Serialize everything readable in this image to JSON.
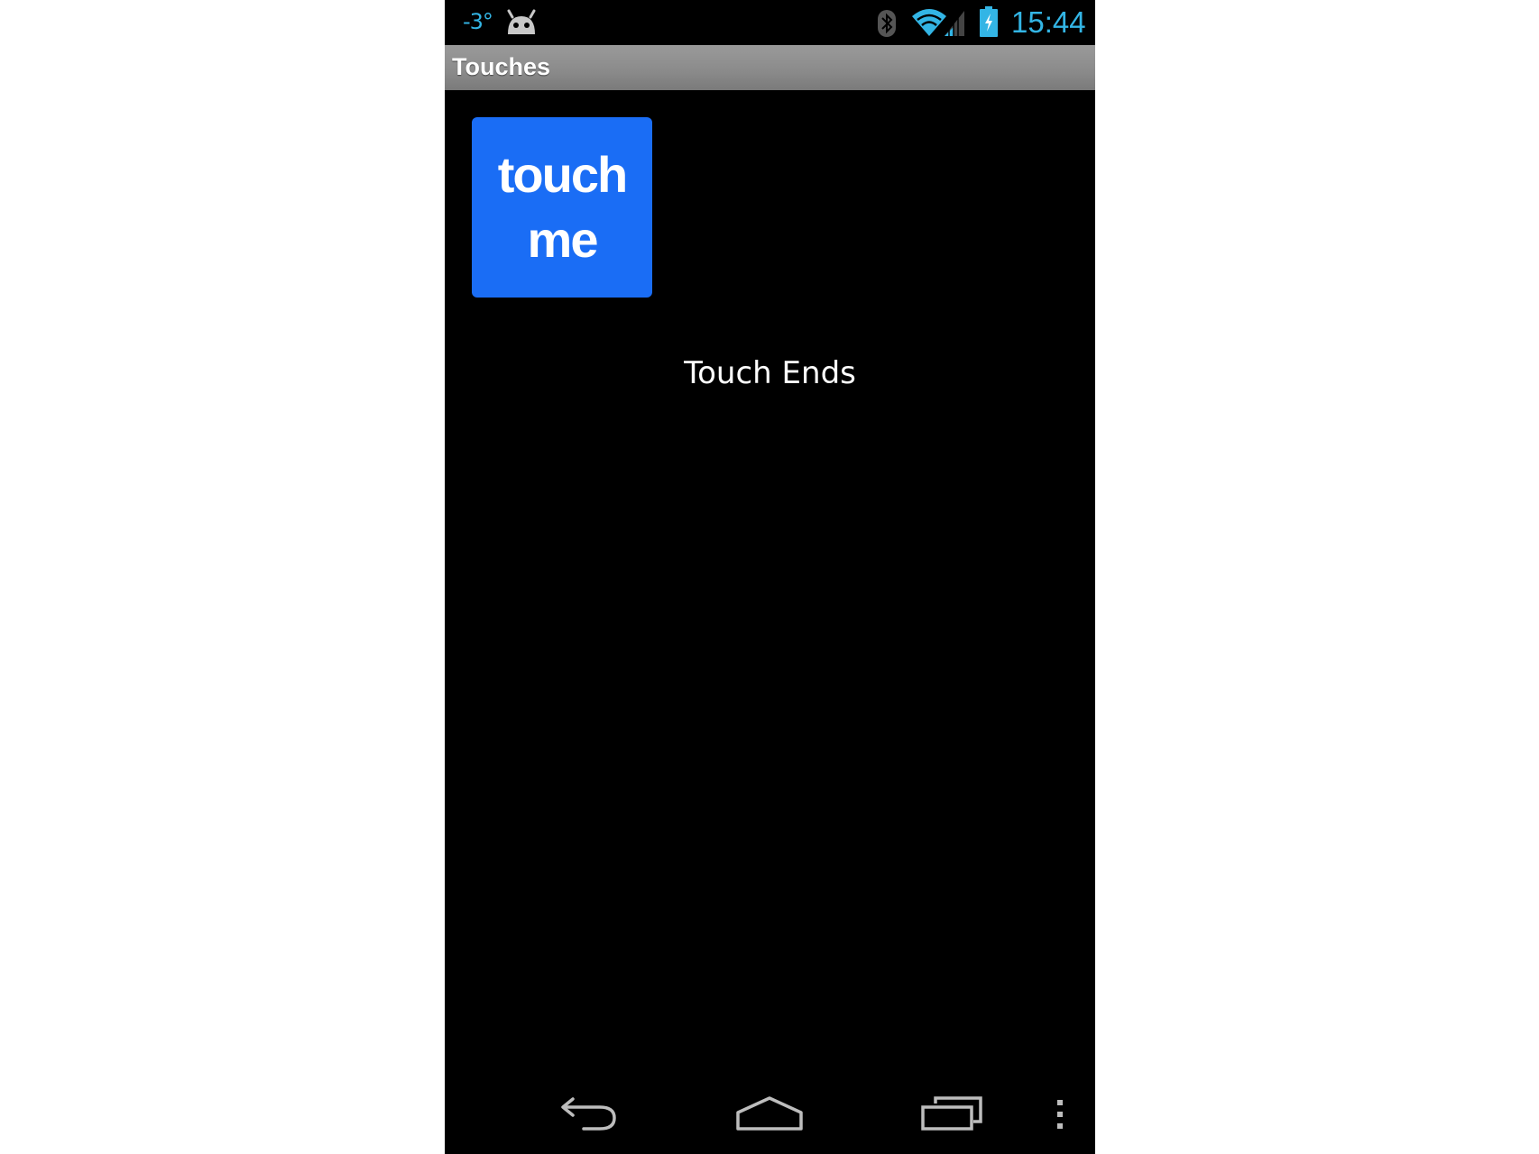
{
  "status_bar": {
    "temperature": "-3°",
    "time": "15:44",
    "icons": [
      "android-icon",
      "bluetooth-icon",
      "wifi-icon",
      "signal-icon",
      "battery-charging-icon"
    ],
    "accent_color": "#33b5e5"
  },
  "app": {
    "title": "Touches"
  },
  "main": {
    "button_line1": "touch",
    "button_line2": "me",
    "button_color": "#1a6df5",
    "status_message": "Touch Ends"
  },
  "nav_bar": {
    "icons": [
      "back-icon",
      "home-icon",
      "recent-apps-icon",
      "overflow-menu-icon"
    ]
  }
}
